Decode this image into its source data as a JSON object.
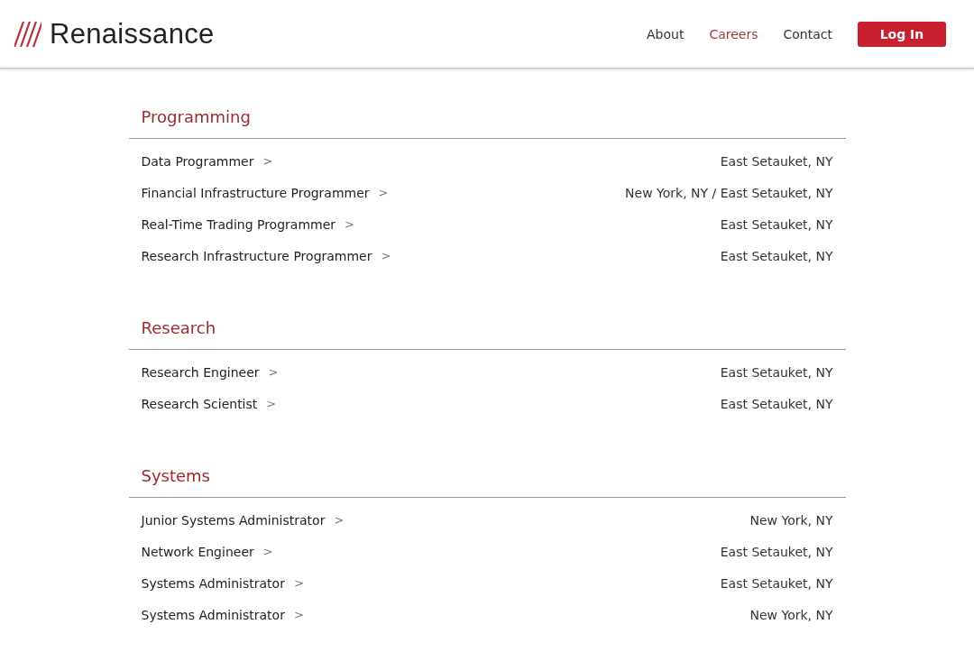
{
  "header": {
    "logo": "Renaissance",
    "nav": [
      {
        "label": "About",
        "selected": false
      },
      {
        "label": "Careers",
        "selected": true
      },
      {
        "label": "Contact",
        "selected": false
      }
    ],
    "login": "Log In"
  },
  "sections": [
    {
      "title": "Programming",
      "jobs": [
        {
          "title": "Data Programmer",
          "arrow": ">",
          "location": "East Setauket, NY"
        },
        {
          "title": "Financial Infrastructure Programmer",
          "arrow": ">",
          "location": "New York, NY / East Setauket, NY"
        },
        {
          "title": "Real-Time Trading Programmer",
          "arrow": ">",
          "location": "East Setauket, NY"
        },
        {
          "title": "Research Infrastructure Programmer",
          "arrow": ">",
          "location": "East Setauket, NY"
        }
      ]
    },
    {
      "title": "Research",
      "jobs": [
        {
          "title": "Research Engineer",
          "arrow": ">",
          "location": "East Setauket, NY"
        },
        {
          "title": "Research Scientist",
          "arrow": ">",
          "location": "East Setauket, NY"
        }
      ]
    },
    {
      "title": "Systems",
      "jobs": [
        {
          "title": "Junior Systems Administrator",
          "arrow": ">",
          "location": "New York, NY"
        },
        {
          "title": "Network Engineer",
          "arrow": ">",
          "location": "East Setauket, NY"
        },
        {
          "title": "Systems Administrator",
          "arrow": ">",
          "location": "East Setauket, NY"
        },
        {
          "title": "Systems Administrator",
          "arrow": ">",
          "location": "New York, NY"
        }
      ]
    }
  ]
}
